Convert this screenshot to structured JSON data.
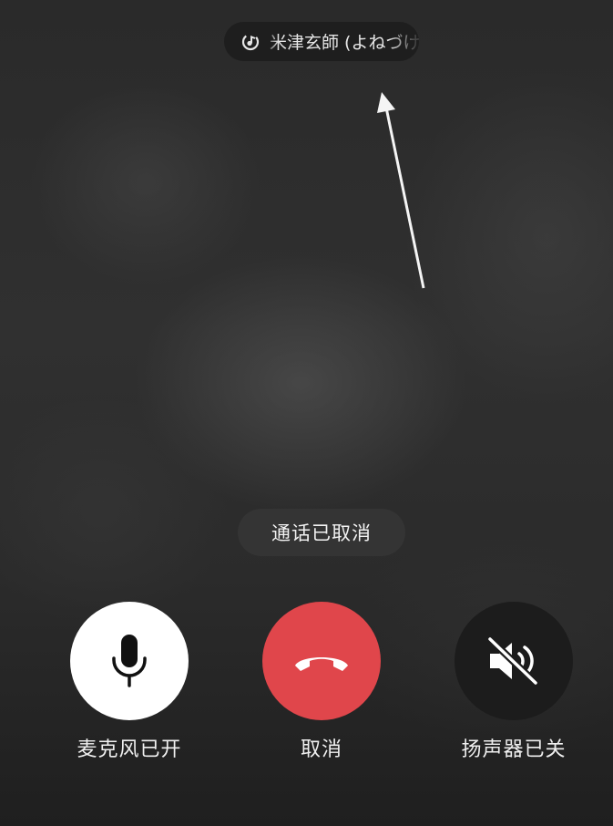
{
  "header": {
    "icon": "music-note-icon",
    "title": "米津玄師 (よねづけんし)"
  },
  "status": {
    "text": "通话已取消"
  },
  "controls": {
    "microphone": {
      "label": "麦克风已开",
      "icon": "microphone-icon",
      "color": "#ffffff"
    },
    "cancel": {
      "label": "取消",
      "icon": "hang-up-phone-icon",
      "color": "#e0464b"
    },
    "speaker": {
      "label": "扬声器已关",
      "icon": "speaker-muted-icon",
      "color": "#1c1c1c"
    }
  },
  "colors": {
    "accent_red": "#e0464b",
    "text": "#f0f0f0"
  }
}
